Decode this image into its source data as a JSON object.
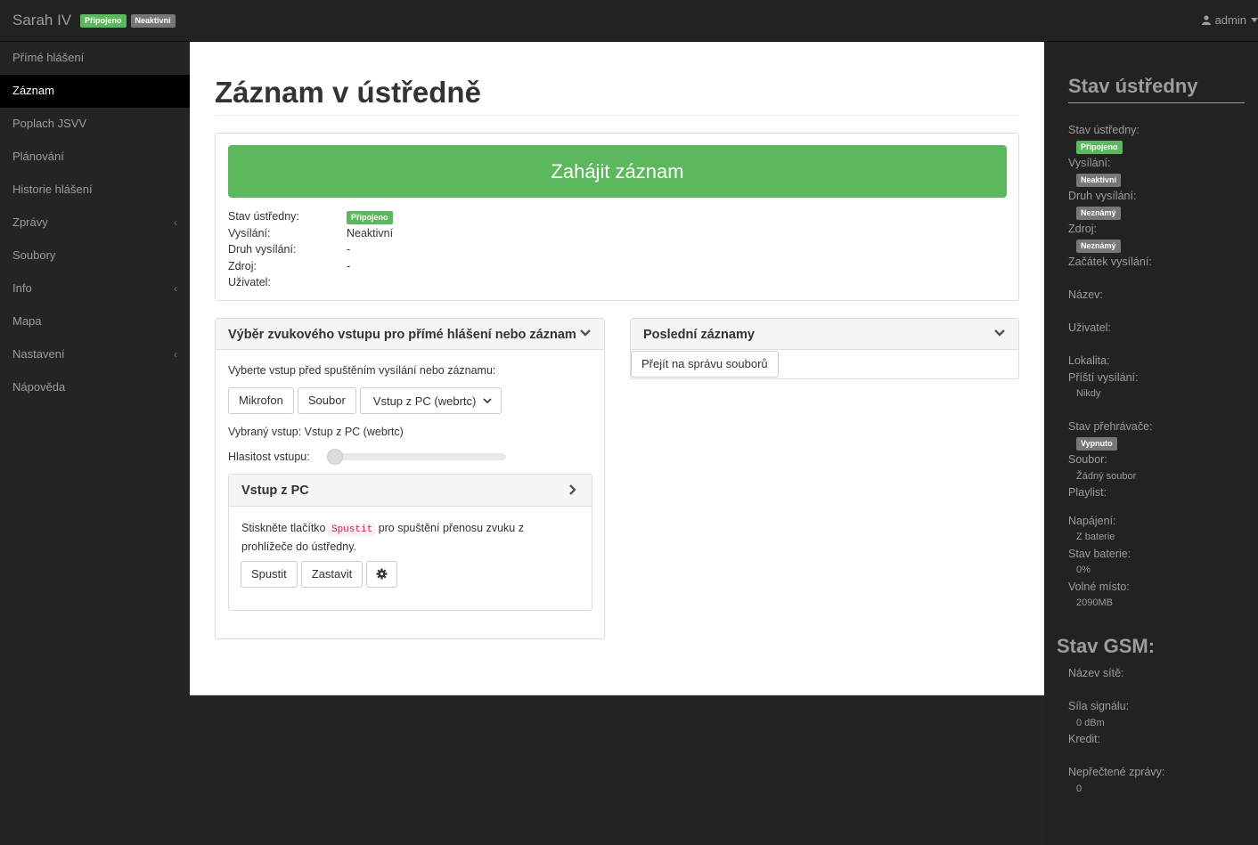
{
  "navbar": {
    "brand": "Sarah IV",
    "badge_connected": "Připojeno",
    "badge_inactive": "Neaktivní",
    "user": "admin",
    "user_icon": "user-icon",
    "caret_icon": "caret-down-icon"
  },
  "sidebar": {
    "items": [
      {
        "label": "Přímé hlášení"
      },
      {
        "label": "Záznam",
        "active": true
      },
      {
        "label": "Poplach JSVV"
      },
      {
        "label": "Plánování"
      },
      {
        "label": "Historie hlášení"
      },
      {
        "label": "Zprávy",
        "has_children": true
      },
      {
        "label": "Soubory"
      },
      {
        "label": "Info",
        "has_children": true
      },
      {
        "label": "Mapa"
      },
      {
        "label": "Nastavení",
        "has_children": true
      },
      {
        "label": "Nápověda"
      }
    ],
    "chevron": "‹"
  },
  "main": {
    "title": "Záznam v ústředně",
    "start_button": "Zahájit záznam",
    "status": {
      "labels": {
        "state": "Stav ústředny:",
        "broadcast": "Vysílání:",
        "kind": "Druh vysílání:",
        "source": "Zdroj:",
        "user": "Uživatel:"
      },
      "values": {
        "state": "Připojeno",
        "broadcast": "Neaktivní",
        "kind": "-",
        "source": "-",
        "user": ""
      }
    },
    "input_panel": {
      "title": "Výběr zvukového vstupu pro přímé hlášení nebo záznam",
      "intro": "Vyberte vstup před spuštěním vysílání nebo záznamu:",
      "btn_mic": "Mikrofon",
      "btn_file": "Soubor",
      "select_value": "Vstup z PC (webrtc)",
      "selected_text": "Vybraný vstup: Vstup z PC (webrtc)",
      "volume_label": "Hlasitost vstupu:",
      "volume_level": 0,
      "sub_panel": {
        "title": "Vstup z PC",
        "text_before": "Stiskněte tlačítko",
        "code": "Spustit",
        "text_after": "pro spuštění přenosu zvuku z",
        "text_line2": "prohlížeče do ústředny.",
        "btn_start": "Spustit",
        "btn_stop": "Zastavit",
        "gear_icon": "gear-icon"
      }
    },
    "recent_panel": {
      "title": "Poslední záznamy",
      "btn_files": "Přejít na správu souborů"
    }
  },
  "rightbar": {
    "title": "Stav ústředny",
    "state_label": "Stav ústředny:",
    "state_value": "Připojeno",
    "broadcast_label": "Vysílání:",
    "broadcast_value": "Neaktivní",
    "kind_label": "Druh vysílání:",
    "kind_value": "Neznámý",
    "source_label": "Zdroj:",
    "source_value": "Neznámý",
    "start_label": "Začátek vysílání:",
    "name_label": "Název:",
    "user_label": "Uživatel:",
    "location_label": "Lokalita:",
    "next_label": "Příští vysílání:",
    "next_value": "Nikdy",
    "player_label": "Stav přehrávače:",
    "player_value": "Vypnuto",
    "file_label": "Soubor:",
    "file_value": "Žádný soubor",
    "playlist_label": "Playlist:",
    "power_label": "Napájení:",
    "power_value": "Z baterie",
    "battery_label": "Stav baterie:",
    "battery_value": "0%",
    "space_label": "Volné místo:",
    "space_value": "2090MB",
    "gsm_title": "Stav GSM:",
    "net_label": "Název sítě:",
    "signal_label": "Síla signálu:",
    "signal_value": "0 dBm",
    "credit_label": "Kredit:",
    "unread_label": "Nepřečtené zprávy:",
    "unread_value": "0"
  },
  "colors": {
    "success": "#5cb85c",
    "default_badge": "#777777",
    "dark": "#222222"
  }
}
